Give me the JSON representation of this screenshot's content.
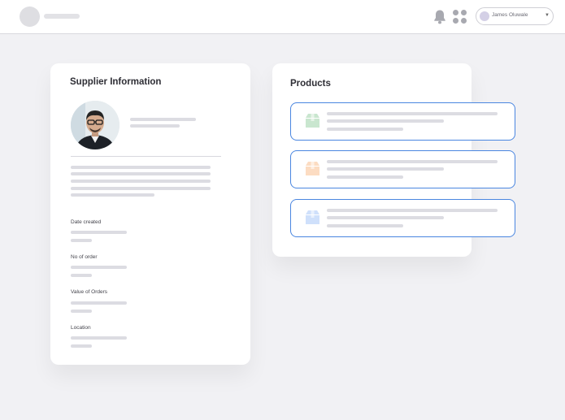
{
  "header": {
    "user_name": "James Oluwale",
    "icons": [
      "bell-icon",
      "apps-grid-icon",
      "chevron-down-icon"
    ]
  },
  "supplier": {
    "title": "Supplier Information",
    "fields": [
      {
        "label": "Date created"
      },
      {
        "label": "No of order"
      },
      {
        "label": "Value of Orders"
      },
      {
        "label": "Location"
      }
    ]
  },
  "products": {
    "title": "Products",
    "items": [
      {
        "icon": "box-icon",
        "color": "#c9e6cf"
      },
      {
        "icon": "box-icon",
        "color": "#fcdcc2"
      },
      {
        "icon": "box-icon",
        "color": "#cfe0fb"
      }
    ]
  },
  "colors": {
    "accent_border": "#4a86e0",
    "background": "#f1f1f4",
    "skeleton": "#dcdce2"
  }
}
